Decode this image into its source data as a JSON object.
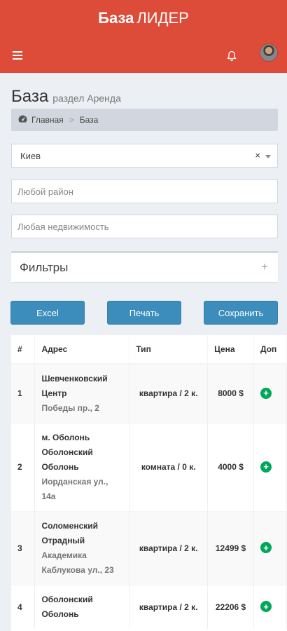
{
  "header": {
    "logo_bold": "База",
    "logo_light": "ЛИДЕР",
    "menu_icon": "hamburger-icon",
    "notifications_icon": "bell-icon",
    "brand_color": "#dd4b39"
  },
  "page": {
    "title": "База",
    "subtitle": "раздел Аренда"
  },
  "breadcrumb": {
    "home_icon": "dashboard-icon",
    "home": "Главная",
    "separator": ">",
    "current": "База"
  },
  "filters_form": {
    "city_value": "Киев",
    "clear_symbol": "×",
    "district_placeholder": "Любой район",
    "property_placeholder": "Любая недвижимость",
    "filters_label": "Фильтры",
    "filters_toggle": "+"
  },
  "actions": {
    "excel": "Excel",
    "print": "Печать",
    "save": "Сохранить"
  },
  "table": {
    "headers": [
      "#",
      "Адрес",
      "Тип",
      "Цена",
      "Доп"
    ],
    "rows": [
      {
        "num": "1",
        "area": "Шевченковский Центр",
        "street": "Победы пр., 2",
        "type": "квартира / 2 к.",
        "price": "8000 $"
      },
      {
        "num": "2",
        "area": "м. Оболонь Оболонский Оболонь",
        "street": "Иорданская ул., 14а",
        "type": "комната / 0 к.",
        "price": "4000 $"
      },
      {
        "num": "3",
        "area": "Соломенский Отрадный",
        "street": "Академика Каблукова ул., 23",
        "type": "квартира / 2 к.",
        "price": "12499 $"
      },
      {
        "num": "4",
        "area": "Оболонский Оболонь",
        "street": "",
        "type": "квартира / 2 к.",
        "price": "22206 $"
      }
    ],
    "row_action_icon": "plus-circle-icon",
    "row_action_color": "#00a65a"
  }
}
